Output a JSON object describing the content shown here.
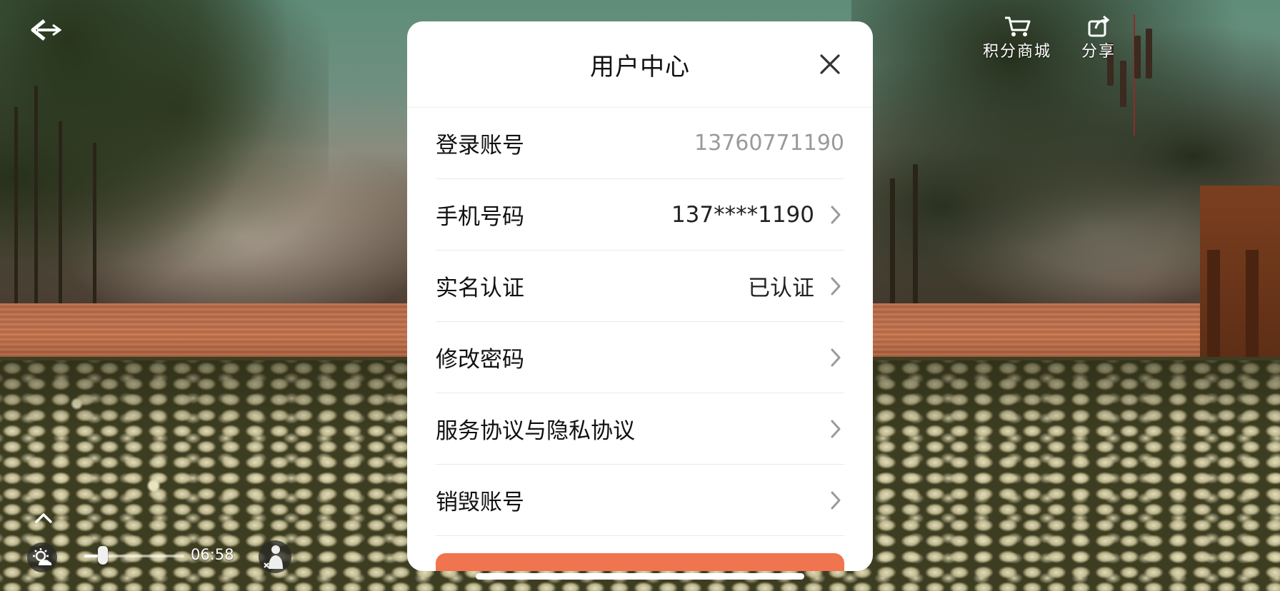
{
  "modal": {
    "title": "用户中心",
    "rows": [
      {
        "label": "登录账号",
        "value": "13760771190",
        "has_chevron": false
      },
      {
        "label": "手机号码",
        "value": "137****1190",
        "has_chevron": true
      },
      {
        "label": "实名认证",
        "value": "已认证",
        "has_chevron": true
      },
      {
        "label": "修改密码",
        "value": "",
        "has_chevron": true
      },
      {
        "label": "服务协议与隐私协议",
        "value": "",
        "has_chevron": true
      },
      {
        "label": "销毁账号",
        "value": "",
        "has_chevron": true
      }
    ]
  },
  "hud": {
    "points_shop_label": "积分商城",
    "share_label": "分享",
    "time": "06:58",
    "time_slider_level": 0.15
  },
  "icons": {
    "back": "back-arrow-icon",
    "shop": "cart-icon",
    "share": "share-icon",
    "close": "close-icon",
    "chevron": "chevron-right-icon",
    "expand": "chevron-up-icon",
    "weather": "weather-icon",
    "avatar": "character-icon"
  },
  "colors": {
    "primary_button": "#f0744f",
    "modal_bg": "#ffffff",
    "muted_text": "#9a9a9a"
  }
}
